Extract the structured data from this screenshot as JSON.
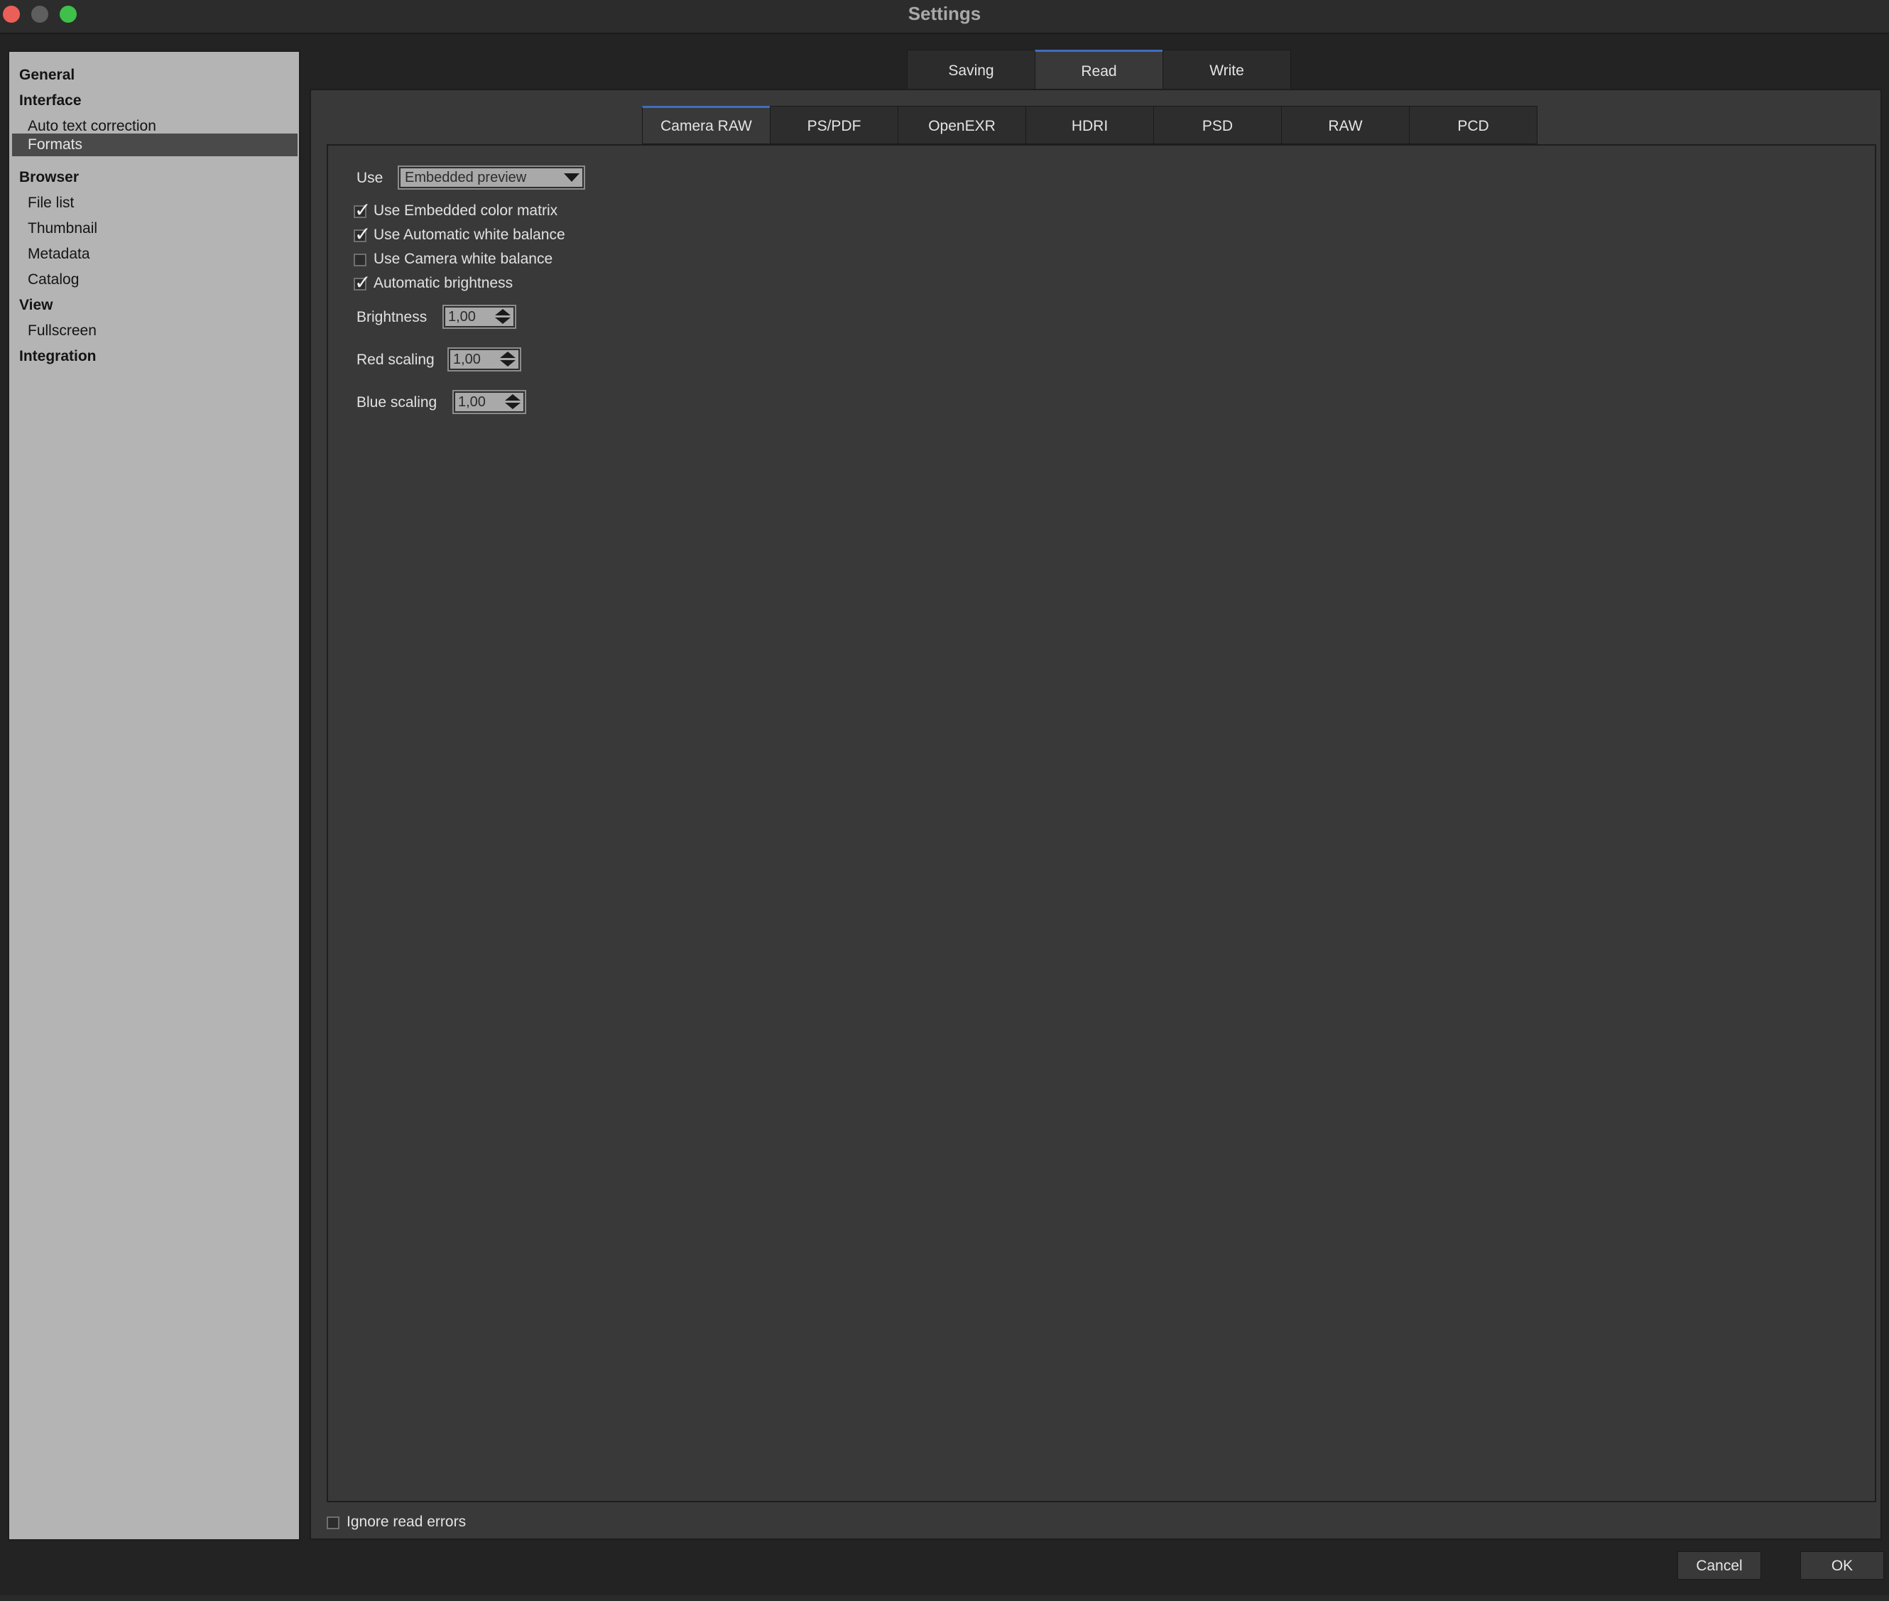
{
  "window": {
    "title": "Settings"
  },
  "sidebar": {
    "items": [
      {
        "label": "General",
        "type": "section"
      },
      {
        "label": "Interface",
        "type": "section"
      },
      {
        "label": "Auto text correction",
        "type": "sub"
      },
      {
        "label": "Formats",
        "type": "sub",
        "selected": true
      },
      {
        "label": "Browser",
        "type": "section"
      },
      {
        "label": "File list",
        "type": "sub"
      },
      {
        "label": "Thumbnail",
        "type": "sub"
      },
      {
        "label": "Metadata",
        "type": "sub"
      },
      {
        "label": "Catalog",
        "type": "sub"
      },
      {
        "label": "View",
        "type": "section"
      },
      {
        "label": "Fullscreen",
        "type": "sub"
      },
      {
        "label": "Integration",
        "type": "section"
      }
    ]
  },
  "top_tabs": {
    "items": [
      {
        "label": "Saving"
      },
      {
        "label": "Read",
        "active": true
      },
      {
        "label": "Write"
      }
    ]
  },
  "sub_tabs": {
    "items": [
      {
        "label": "Camera RAW",
        "active": true
      },
      {
        "label": "PS/PDF"
      },
      {
        "label": "OpenEXR"
      },
      {
        "label": "HDRI"
      },
      {
        "label": "PSD"
      },
      {
        "label": "RAW"
      },
      {
        "label": "PCD"
      }
    ]
  },
  "camera_raw": {
    "use_label": "Use",
    "use_value": "Embedded preview",
    "checkboxes": [
      {
        "label": "Use Embedded color matrix",
        "checked": true
      },
      {
        "label": "Use Automatic white balance",
        "checked": true
      },
      {
        "label": "Use Camera white balance",
        "checked": false
      },
      {
        "label": "Automatic brightness",
        "checked": true
      }
    ],
    "brightness": {
      "label": "Brightness",
      "value": "1,00"
    },
    "red_scaling": {
      "label": "Red scaling",
      "value": "1,00"
    },
    "blue_scaling": {
      "label": "Blue scaling",
      "value": "1,00"
    }
  },
  "ignore_read_errors": {
    "label": "Ignore read errors",
    "checked": false
  },
  "buttons": {
    "cancel": "Cancel",
    "ok": "OK"
  },
  "colors": {
    "accent": "#3f6ec0",
    "sidebar_bg": "#b4b4b4",
    "panel_bg": "#393939"
  }
}
